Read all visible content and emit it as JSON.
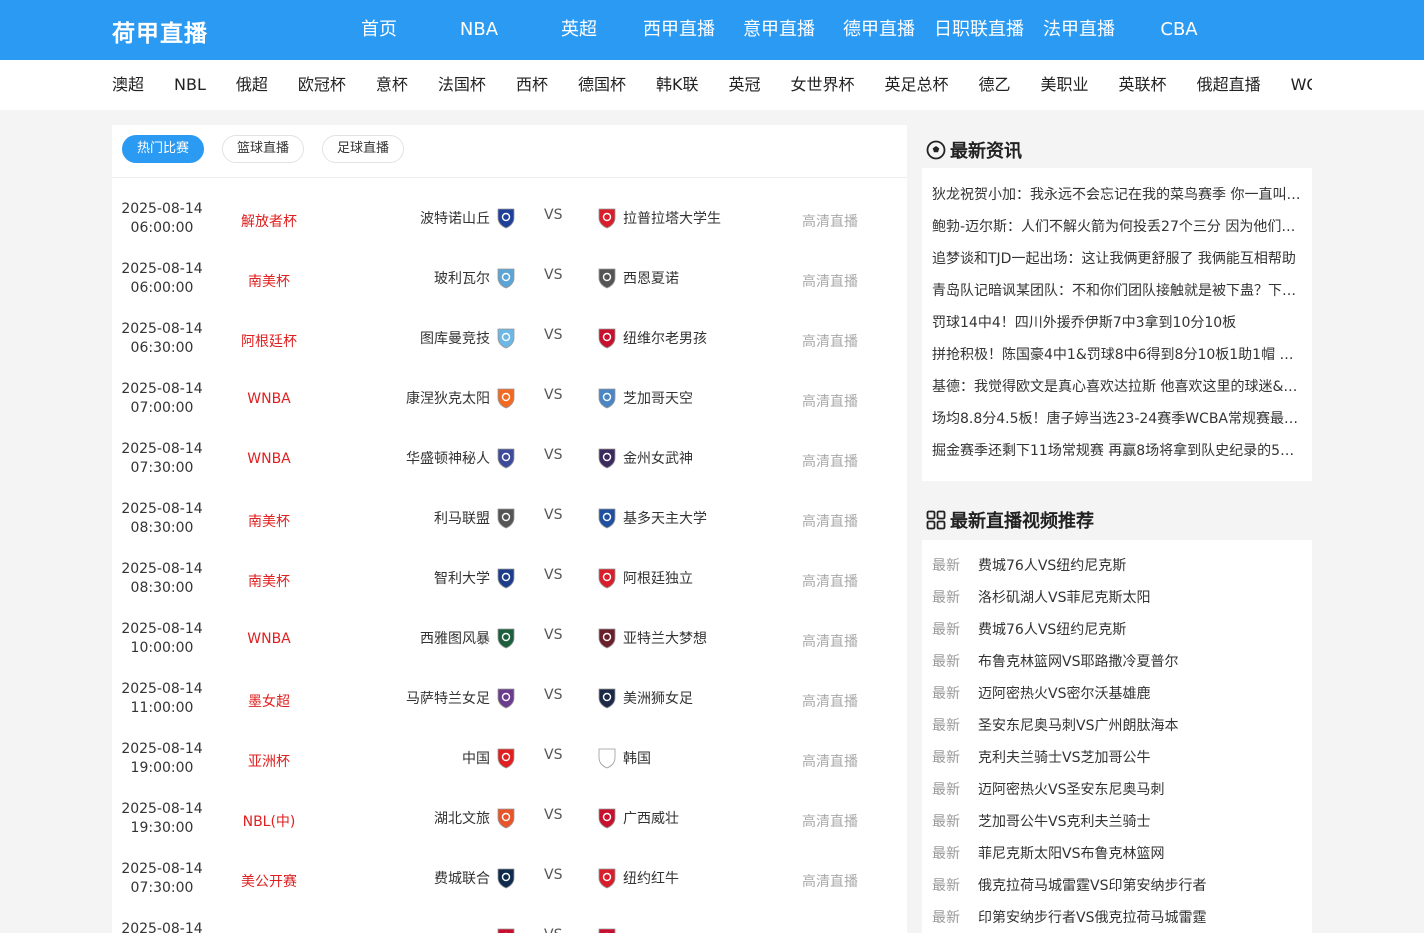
{
  "header": {
    "logo": "荷甲直播",
    "nav": [
      "首页",
      "NBA",
      "英超",
      "西甲直播",
      "意甲直播",
      "德甲直播",
      "日职联直播",
      "法甲直播",
      "CBA"
    ]
  },
  "subnav": [
    "澳超",
    "NBL",
    "俄超",
    "欧冠杯",
    "意杯",
    "法国杯",
    "西杯",
    "德国杯",
    "韩K联",
    "英冠",
    "女世界杯",
    "英足总杯",
    "德乙",
    "美职业",
    "英联杯",
    "俄超直播",
    "WC"
  ],
  "tabs": [
    "热门比赛",
    "篮球直播",
    "足球直播"
  ],
  "live_label": "高清直播",
  "vs_label": "VS",
  "matches": [
    {
      "date": "2025-08-14",
      "time": "06:00:00",
      "league": "解放者杯",
      "home": "波特诺山丘",
      "away": "拉普拉塔大学生"
    },
    {
      "date": "2025-08-14",
      "time": "06:00:00",
      "league": "南美杯",
      "home": "玻利瓦尔",
      "away": "西恩夏诺"
    },
    {
      "date": "2025-08-14",
      "time": "06:30:00",
      "league": "阿根廷杯",
      "home": "图库曼竞技",
      "away": "纽维尔老男孩"
    },
    {
      "date": "2025-08-14",
      "time": "07:00:00",
      "league": "WNBA",
      "home": "康涅狄克太阳",
      "away": "芝加哥天空"
    },
    {
      "date": "2025-08-14",
      "time": "07:30:00",
      "league": "WNBA",
      "home": "华盛顿神秘人",
      "away": "金州女武神"
    },
    {
      "date": "2025-08-14",
      "time": "08:30:00",
      "league": "南美杯",
      "home": "利马联盟",
      "away": "基多天主大学"
    },
    {
      "date": "2025-08-14",
      "time": "08:30:00",
      "league": "南美杯",
      "home": "智利大学",
      "away": "阿根廷独立"
    },
    {
      "date": "2025-08-14",
      "time": "10:00:00",
      "league": "WNBA",
      "home": "西雅图风暴",
      "away": "亚特兰大梦想"
    },
    {
      "date": "2025-08-14",
      "time": "11:00:00",
      "league": "墨女超",
      "home": "马萨特兰女足",
      "away": "美洲狮女足"
    },
    {
      "date": "2025-08-14",
      "time": "19:00:00",
      "league": "亚洲杯",
      "home": "中国",
      "away": "韩国"
    },
    {
      "date": "2025-08-14",
      "time": "19:30:00",
      "league": "NBL(中)",
      "home": "湖北文旅",
      "away": "广西威壮"
    },
    {
      "date": "2025-08-14",
      "time": "07:30:00",
      "league": "美公开赛",
      "home": "费城联合",
      "away": "纽约红牛"
    },
    {
      "date": "2025-08-14",
      "time": "",
      "league": "",
      "home": "",
      "away": ""
    }
  ],
  "news": {
    "title": "最新资讯",
    "items": [
      "狄龙祝贺小加：我永远不会忘记在我的菜鸟赛季 你一直叫…",
      "鲍勃-迈尔斯：人们不解火箭为何投丢27个三分 因为他们…",
      "追梦谈和TJD一起出场：这让我俩更舒服了 我俩能互相帮助",
      "青岛队记暗讽某团队：不和你们团队接触就是被下蛊？下…",
      "罚球14中4！四川外援乔伊斯7中3拿到10分10板",
      "拼抢积极！陈国豪4中1&罚球8中6得到8分10板1助1帽 有…",
      "基德：我觉得欧文是真心喜欢达拉斯 他喜欢这里的球迷&…",
      "场均8.8分4.5板！唐子婷当选23-24赛季WCBA常规赛最…",
      "掘金赛季还剩下11场常规赛 再赢8场将拿到队史纪录的58胜"
    ]
  },
  "videos": {
    "title": "最新直播视频推荐",
    "tag": "最新",
    "items": [
      "费城76人VS纽约尼克斯",
      "洛杉矶湖人VS菲尼克斯太阳",
      "费城76人VS纽约尼克斯",
      "布鲁克林篮网VS耶路撒冷夏普尔",
      "迈阿密热火VS密尔沃基雄鹿",
      "圣安东尼奥马刺VS广州朗肽海本",
      "克利夫兰骑士VS芝加哥公牛",
      "迈阿密热火VS圣安东尼奥马刺",
      "芝加哥公牛VS克利夫兰骑士",
      "菲尼克斯太阳VS布鲁克林篮网",
      "俄克拉荷马城雷霆VS印第安纳步行者",
      "印第安纳步行者VS俄克拉荷马城雷霆"
    ]
  },
  "colors": {
    "brand": "#2b9af3",
    "league": "#e02020",
    "muted": "#aaaaaa"
  },
  "badge_colors_home": [
    "#1f3f99",
    "#5ba4d6",
    "#6cb7e6",
    "#f26a21",
    "#3e4b9b",
    "#555555",
    "#1e3c8c",
    "#1d5e3c",
    "#6a3c8e",
    "#e02020",
    "#e8542a",
    "#0e2a4d",
    "#c8102e"
  ],
  "badge_colors_away": [
    "#d81e2b",
    "#555555",
    "#c8102e",
    "#4a86c5",
    "#3b2a5e",
    "#1e4fa0",
    "#d81e2b",
    "#6a1f2b",
    "#1c2a48",
    "#ffffff",
    "#c8102e",
    "#d81e2b",
    "#c8102e"
  ]
}
